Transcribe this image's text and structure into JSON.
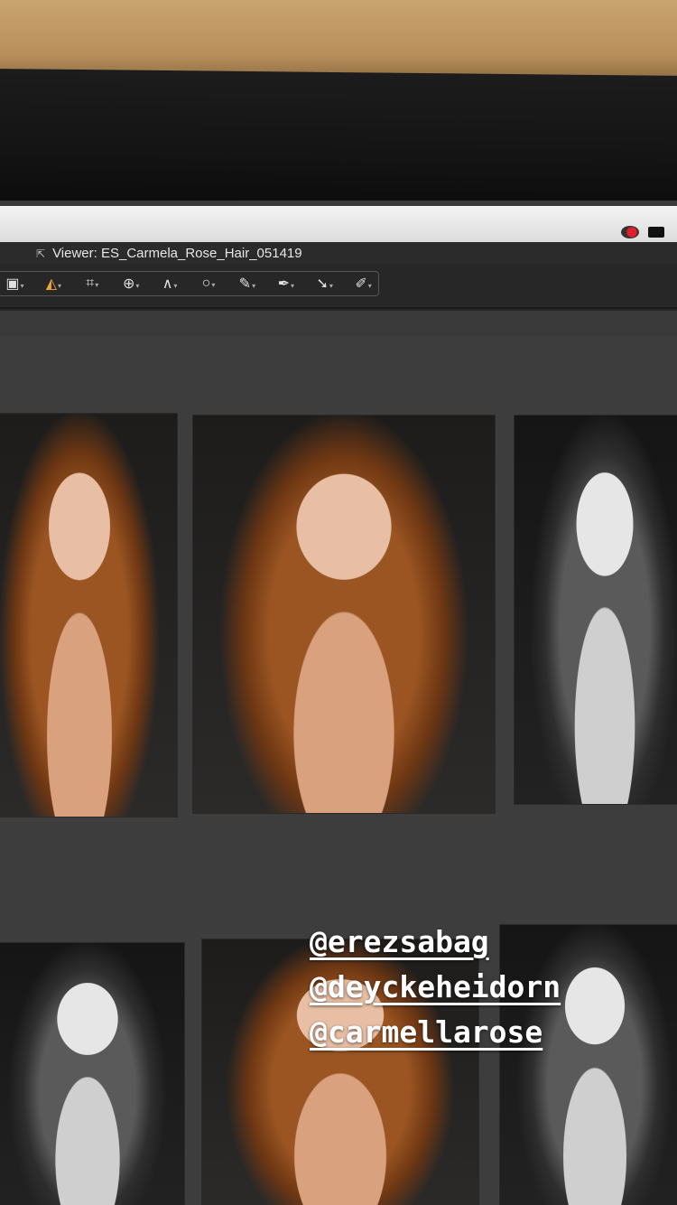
{
  "window": {
    "title": "Viewer: ES_Carmela_Rose_Hair_051419"
  },
  "toolbar": {
    "tools": [
      {
        "icon": "select-icon",
        "glyph": "▣"
      },
      {
        "icon": "bucket-icon",
        "glyph": "◭"
      },
      {
        "icon": "crop-icon",
        "glyph": "⌗"
      },
      {
        "icon": "rotate-icon",
        "glyph": "⊕"
      },
      {
        "icon": "keystone-icon",
        "glyph": "∧"
      },
      {
        "icon": "circle-icon",
        "glyph": "○"
      },
      {
        "icon": "brush-icon",
        "glyph": "✎"
      },
      {
        "icon": "eyedropper-icon",
        "glyph": "✒"
      },
      {
        "icon": "pick-icon",
        "glyph": "➘"
      },
      {
        "icon": "eraser-icon",
        "glyph": "✐"
      }
    ]
  },
  "story": {
    "mentions": [
      "@erezsabag",
      "@deyckeheidorn",
      "@carmellarose"
    ]
  },
  "colors": {
    "menubar": "#e8e8e8",
    "panel": "#2b2b2b",
    "grid_background": "#3d3d3d",
    "accent": "#f0a23a"
  }
}
